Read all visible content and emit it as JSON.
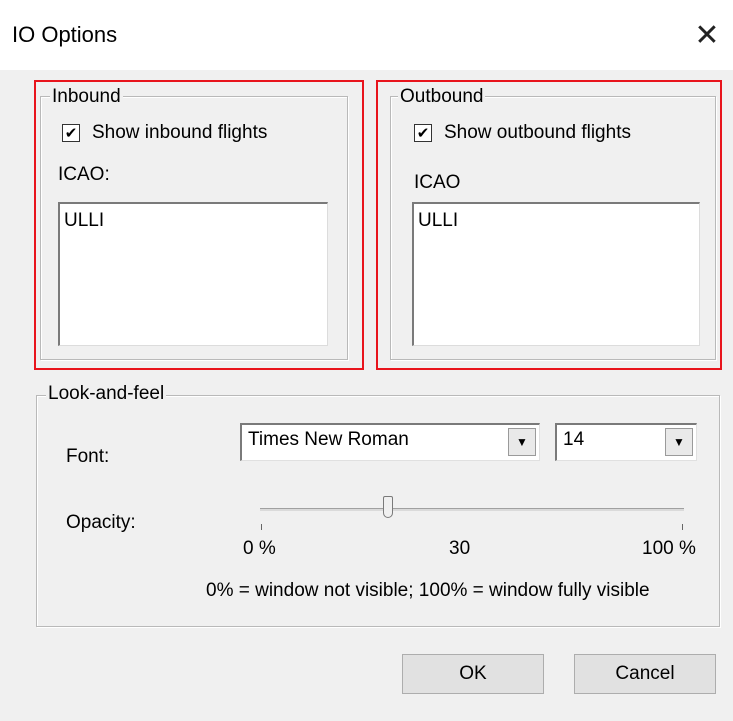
{
  "window": {
    "title": "IO Options",
    "close_icon": "close-icon"
  },
  "inbound": {
    "group_label": "Inbound",
    "show_checkbox_label": "Show inbound flights",
    "show_checked": true,
    "icao_label": "ICAO:",
    "icao_value": "ULLI"
  },
  "outbound": {
    "group_label": "Outbound",
    "show_checkbox_label": "Show outbound flights",
    "show_checked": true,
    "icao_label": "ICAO",
    "icao_value": "ULLI"
  },
  "look_and_feel": {
    "group_label": "Look-and-feel",
    "font_label": "Font:",
    "font_value": "Times New Roman",
    "font_size_value": "14",
    "opacity_label": "Opacity:",
    "opacity_level": 30,
    "tick_min": "0 %",
    "tick_mid": "30",
    "tick_max": "100 %",
    "hint": "0% = window not visible; 100% = window fully visible"
  },
  "buttons": {
    "ok": "OK",
    "cancel": "Cancel"
  },
  "colors": {
    "highlight": "#e8141c",
    "background": "#f0f0f0"
  },
  "check_glyph": "✔"
}
